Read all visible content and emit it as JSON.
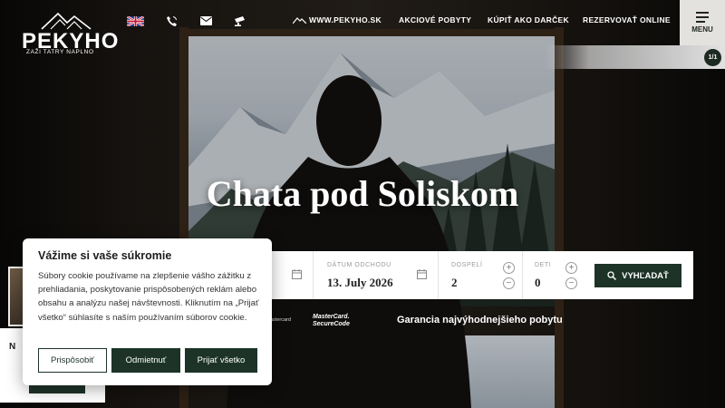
{
  "header": {
    "logo": {
      "name": "PEKYHO",
      "tagline": "ZAŽI TATRY NAPLNO"
    },
    "icons": [
      "uk-flag-icon",
      "phone-icon",
      "mail-icon",
      "camera-icon"
    ],
    "nav": [
      {
        "label": "WWW.PEKYHO.SK",
        "icon": "mountain-icon"
      },
      {
        "label": "AKCIOVÉ POBYTY"
      },
      {
        "label": "KÚPIŤ AKO DARČEK"
      },
      {
        "label": "REZERVOVAŤ ONLINE"
      }
    ],
    "menu_label": "MENU",
    "slide_counter": "1/1"
  },
  "hero": {
    "title": "Chata pod Soliskom"
  },
  "booking": {
    "checkout_label": "DÁTUM ODCHODU",
    "checkout_value": "13. July 2026",
    "adults_label": "DOSPELÍ",
    "adults_value": "2",
    "children_label": "DETI",
    "children_value": "0",
    "search_label": "VYHĽADAŤ"
  },
  "payments": {
    "mini": "astercard",
    "securecode_line1": "MasterCard.",
    "securecode_line2": "SecureCode",
    "guarantee": "Garancia najvýhodnejšieho pobytu"
  },
  "side": {
    "letter": "N"
  },
  "cookie": {
    "title": "Vážime si vaše súkromie",
    "text": "Súbory cookie používame na zlepšenie vášho zážitku z prehliadania, poskytovanie prispôsobených reklám alebo obsahu a analýzu našej návštevnosti. Kliknutím na „Prijať všetko“ súhlasíte s naším používaním súborov cookie.",
    "customize": "Prispôsobiť",
    "reject": "Odmietnuť",
    "accept": "Prijať všetko"
  },
  "colors": {
    "brand_dark": "#1d3328",
    "menu_bg": "#e4e2de"
  }
}
